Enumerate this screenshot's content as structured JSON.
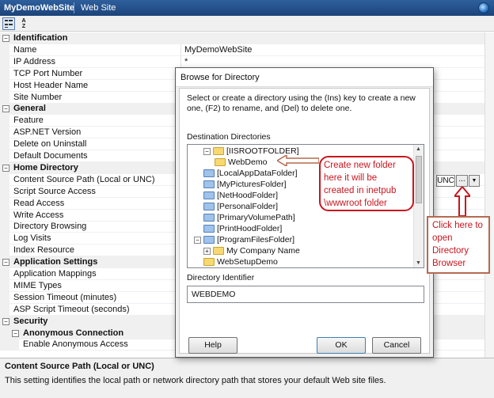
{
  "titlebar": {
    "app_name": "MyDemoWebSite",
    "tab": "Web Site"
  },
  "toolbar": {
    "sort_icon_text": "A Z"
  },
  "grid": {
    "rows": [
      {
        "kind": "cat",
        "label": "Identification",
        "toggle": "−"
      },
      {
        "kind": "prop",
        "label": "Name",
        "value": "MyDemoWebSite"
      },
      {
        "kind": "prop",
        "label": "IP Address",
        "value": "*"
      },
      {
        "kind": "prop",
        "label": "TCP Port Number",
        "value": ""
      },
      {
        "kind": "prop",
        "label": "Host Header Name",
        "value": ""
      },
      {
        "kind": "prop",
        "label": "Site Number",
        "value": ""
      },
      {
        "kind": "cat",
        "label": "General",
        "toggle": "−"
      },
      {
        "kind": "prop",
        "label": "Feature",
        "value": ""
      },
      {
        "kind": "prop",
        "label": "ASP.NET Version",
        "value": ""
      },
      {
        "kind": "prop",
        "label": "Delete on Uninstall",
        "value": ""
      },
      {
        "kind": "prop",
        "label": "Default Documents",
        "value": ""
      },
      {
        "kind": "cat",
        "label": "Home Directory",
        "toggle": "−"
      },
      {
        "kind": "prop",
        "label": "Content Source Path (Local or UNC)",
        "value": ""
      },
      {
        "kind": "prop",
        "label": "Script Source Access",
        "value": ""
      },
      {
        "kind": "prop",
        "label": "Read Access",
        "value": ""
      },
      {
        "kind": "prop",
        "label": "Write Access",
        "value": ""
      },
      {
        "kind": "prop",
        "label": "Directory Browsing",
        "value": ""
      },
      {
        "kind": "prop",
        "label": "Log Visits",
        "value": ""
      },
      {
        "kind": "prop",
        "label": "Index Resource",
        "value": ""
      },
      {
        "kind": "cat",
        "label": "Application Settings",
        "toggle": "−"
      },
      {
        "kind": "prop",
        "label": "Application Mappings",
        "value": ""
      },
      {
        "kind": "prop",
        "label": "MIME Types",
        "value": ""
      },
      {
        "kind": "prop",
        "label": "Session Timeout (minutes)",
        "value": ""
      },
      {
        "kind": "prop",
        "label": "ASP Script Timeout (seconds)",
        "value": ""
      },
      {
        "kind": "cat",
        "label": "Security",
        "toggle": "−"
      },
      {
        "kind": "subcat",
        "label": "Anonymous Connection",
        "toggle": "−"
      },
      {
        "kind": "sub",
        "label": "Enable Anonymous Access",
        "value": ""
      }
    ],
    "unc_label": "UNC",
    "ellipsis_label": "...",
    "dropdown_label": "▼"
  },
  "description": {
    "title": "Content Source Path (Local or UNC)",
    "text": "This setting identifies the local path or network directory path that stores your default Web site files."
  },
  "dialog": {
    "title": "Browse for Directory",
    "instructions": "Select or create a directory using the (Ins) key to create a new one, (F2) to rename, and (Del) to delete one.",
    "dest_label": "Destination Directories",
    "tree": [
      {
        "label": "[IISROOTFOLDER]",
        "color": "yellow",
        "pm": "−"
      },
      {
        "label": "WebDemo",
        "color": "yellow",
        "pm": ""
      },
      {
        "label": "[LocalAppDataFolder]",
        "color": "blue",
        "pm": ""
      },
      {
        "label": "[MyPicturesFolder]",
        "color": "blue",
        "pm": ""
      },
      {
        "label": "[NetHoodFolder]",
        "color": "blue",
        "pm": ""
      },
      {
        "label": "[PersonalFolder]",
        "color": "blue",
        "pm": ""
      },
      {
        "label": "[PrimaryVolumePath]",
        "color": "blue",
        "pm": ""
      },
      {
        "label": "[PrintHoodFolder]",
        "color": "blue",
        "pm": ""
      },
      {
        "label": "[ProgramFilesFolder]",
        "color": "blue",
        "pm": "−"
      },
      {
        "label": "My Company Name",
        "color": "yellow",
        "pm": "+"
      },
      {
        "label": "WebSetupDemo",
        "color": "yellow",
        "pm": ""
      }
    ],
    "identifier_label": "Directory Identifier",
    "identifier_value": "WEBDEMO",
    "help_label": "Help",
    "ok_label": "OK",
    "cancel_label": "Cancel"
  },
  "annotations": {
    "callout_folder": "Create new folder here it will be created in inetpub \\wwwroot folder",
    "callout_browser": "Click here to open Directory Browser",
    "accent_color": "#c9151e"
  }
}
